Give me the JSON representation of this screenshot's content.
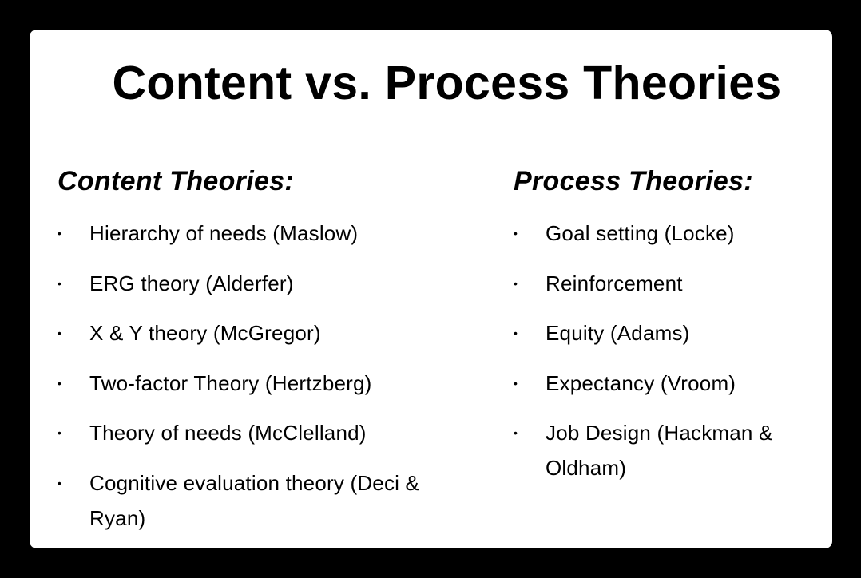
{
  "slide": {
    "title": "Content vs. Process Theories",
    "bullet_glyph": "•",
    "content": {
      "heading": "Content Theories:",
      "items": [
        "Hierarchy of needs (Maslow)",
        "ERG theory (Alderfer)",
        "X & Y theory (McGregor)",
        "Two-factor Theory (Hertzberg)",
        "Theory of needs (McClelland)",
        "Cognitive evaluation theory (Deci & Ryan)"
      ]
    },
    "process": {
      "heading": "Process Theories:",
      "items": [
        "Goal setting  (Locke)",
        "Reinforcement",
        "Equity (Adams)",
        "Expectancy  (Vroom)",
        "Job Design (Hackman & Oldham)"
      ]
    }
  },
  "colors": {
    "frame": "#000000",
    "slide_background": "#ffffff",
    "text": "#000000"
  }
}
